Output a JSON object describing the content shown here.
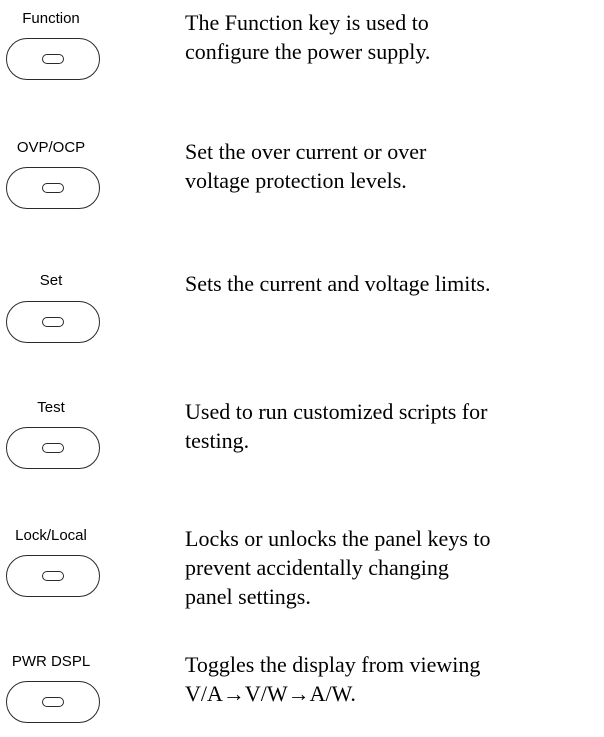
{
  "keys": [
    {
      "label": "Function",
      "description": [
        "The Function key is used to",
        "configure the power supply."
      ]
    },
    {
      "label": "OVP/OCP",
      "description": [
        "Set the over current or over",
        "voltage protection levels."
      ]
    },
    {
      "label": "Set",
      "description": [
        "Sets the current and voltage limits."
      ]
    },
    {
      "label": "Test",
      "description": [
        "Used to run customized scripts for",
        "testing."
      ]
    },
    {
      "label": "Lock/Local",
      "description": [
        "Locks or unlocks the panel keys to",
        "prevent accidentally changing",
        "panel settings."
      ]
    },
    {
      "label": "PWR DSPL",
      "description": [
        "Toggles the display from viewing",
        "V/A→V/W→A/W."
      ]
    }
  ]
}
